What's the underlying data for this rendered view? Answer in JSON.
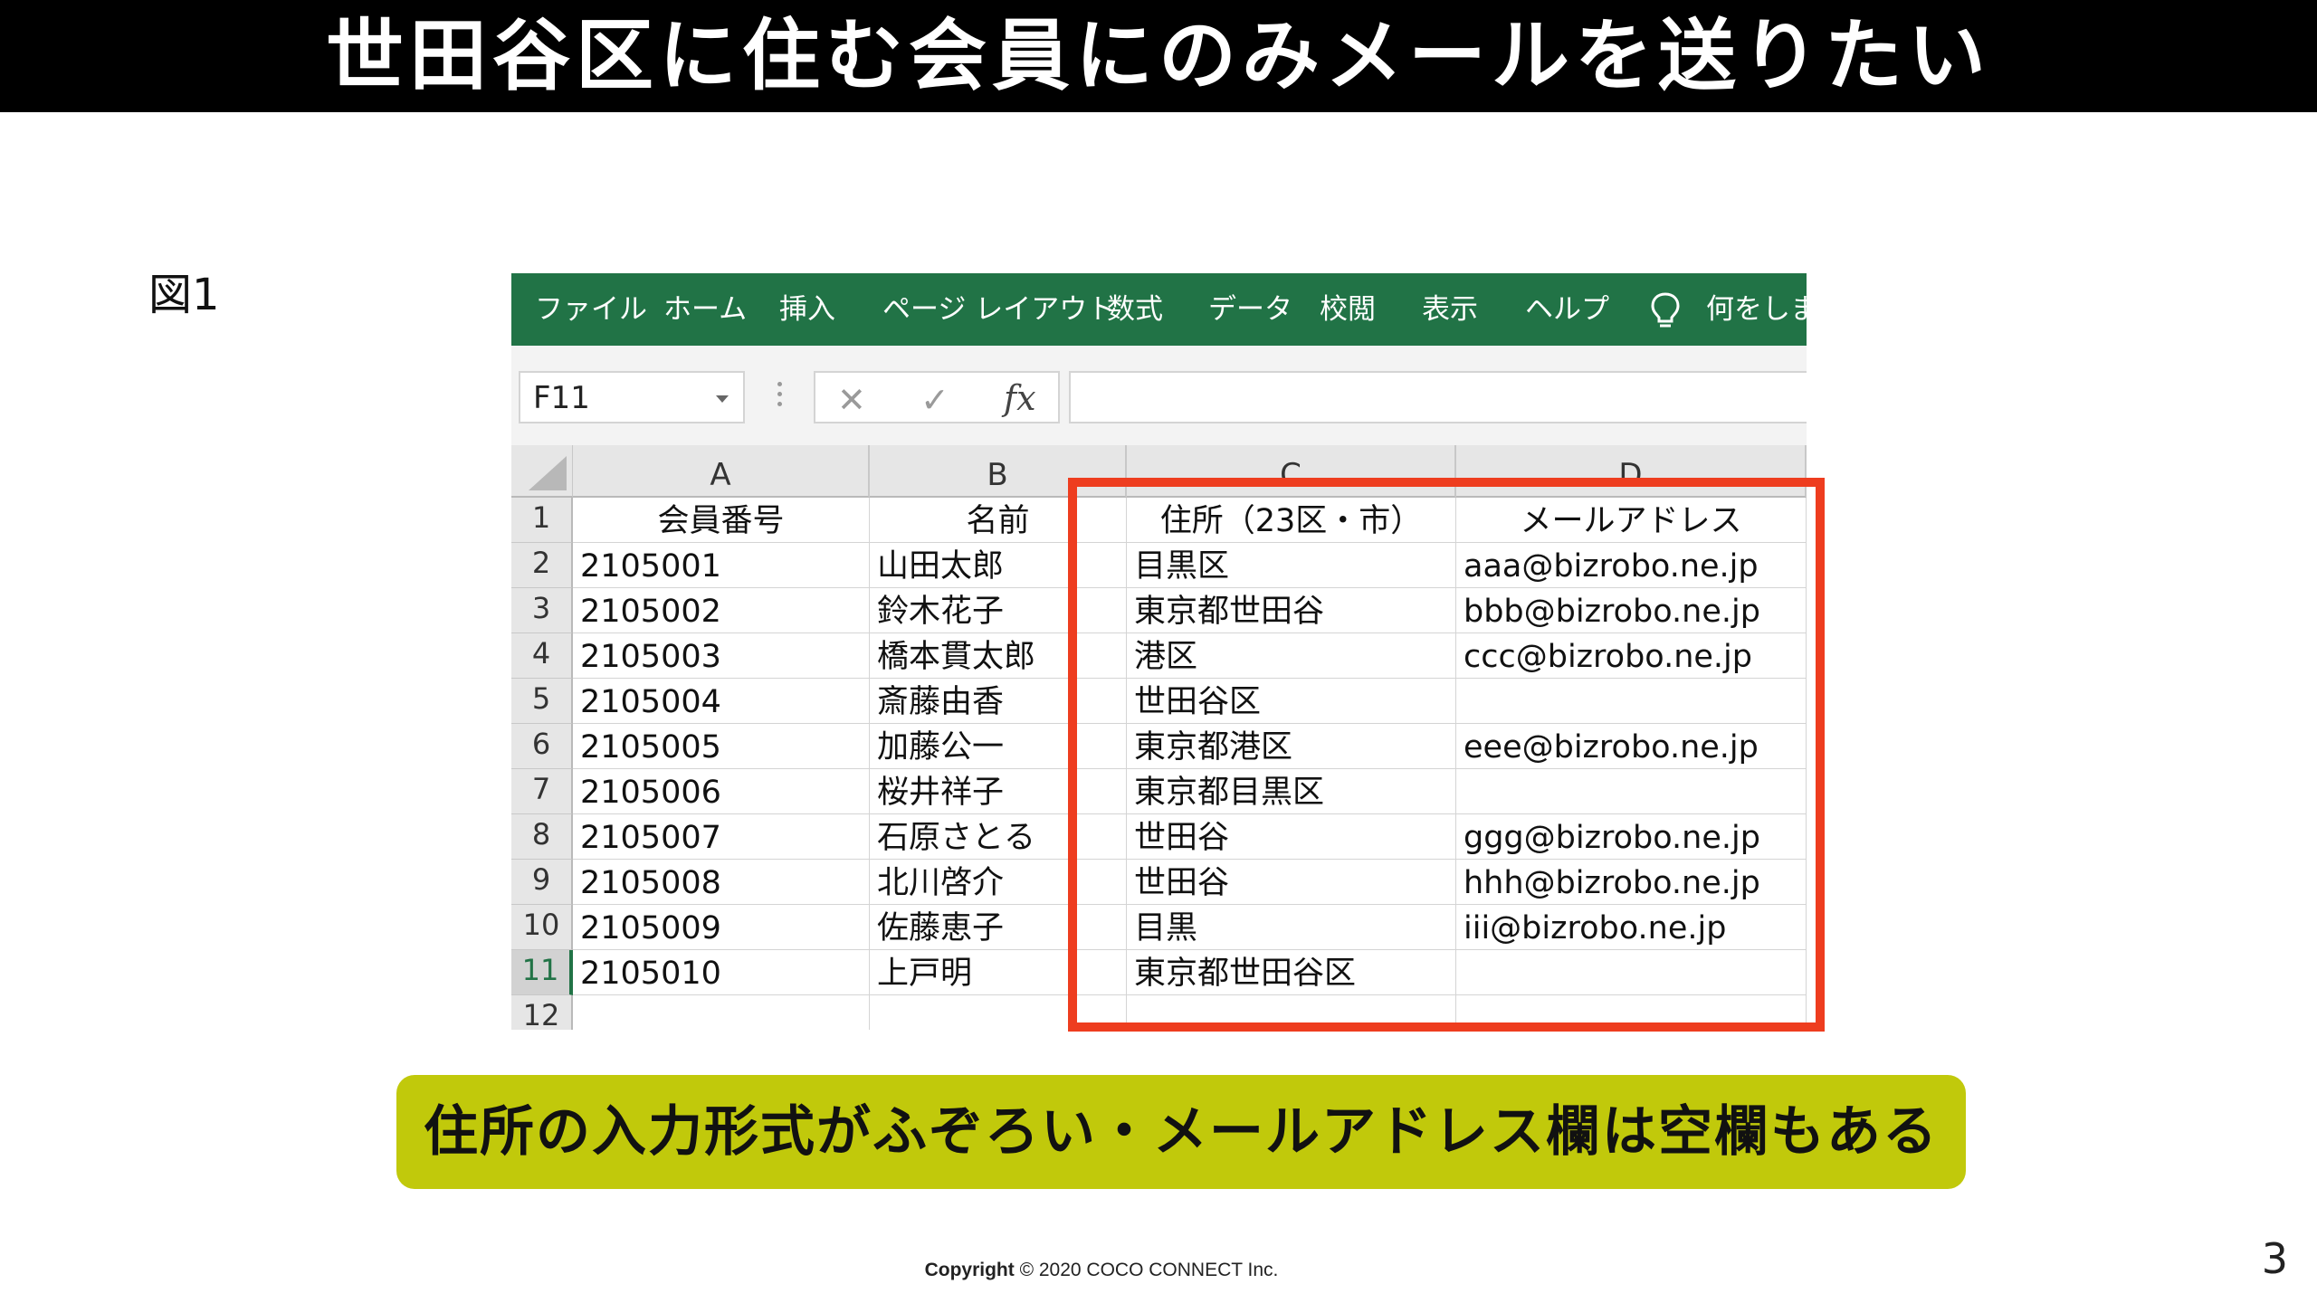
{
  "slide": {
    "title": "世田谷区に住む会員にのみメールを送りたい",
    "figure_label": "図1",
    "callout": "住所の入力形式がふぞろい・メールアドレス欄は空欄もある",
    "copyright_prefix": "Copyright",
    "copyright_rest": " © 2020 COCO CONNECT Inc.",
    "page_number": "3",
    "highlight_color": "#ee3d1f",
    "callout_color": "#c1c90b"
  },
  "excel": {
    "accent_color": "#217346",
    "ribbon_tabs": [
      "ファイル",
      "ホーム",
      "挿入",
      "ページ レイアウト",
      "数式",
      "データ",
      "校閲",
      "表示",
      "ヘルプ"
    ],
    "tell_me_icon": "lightbulb-icon",
    "tell_me_text": "何をします",
    "name_box": "F11",
    "fx_cancel_icon": "✕",
    "fx_enter_icon": "✓",
    "fx_label": "fx",
    "formula_value": "",
    "column_headers": [
      "A",
      "B",
      "C",
      "D"
    ],
    "row_numbers": [
      "1",
      "2",
      "3",
      "4",
      "5",
      "6",
      "7",
      "8",
      "9",
      "10",
      "11",
      "12"
    ],
    "active_row": "11",
    "header_row": [
      "会員番号",
      "名前",
      "住所（23区・市）",
      "メールアドレス"
    ],
    "rows": [
      [
        "2105001",
        "山田太郎",
        "目黒区",
        "aaa@bizrobo.ne.jp"
      ],
      [
        "2105002",
        "鈴木花子",
        "東京都世田谷",
        "bbb@bizrobo.ne.jp"
      ],
      [
        "2105003",
        "橋本貫太郎",
        "港区",
        "ccc@bizrobo.ne.jp"
      ],
      [
        "2105004",
        "斎藤由香",
        "世田谷区",
        ""
      ],
      [
        "2105005",
        "加藤公一",
        "東京都港区",
        "eee@bizrobo.ne.jp"
      ],
      [
        "2105006",
        "桜井祥子",
        "東京都目黒区",
        ""
      ],
      [
        "2105007",
        "石原さとる",
        "世田谷",
        "ggg@bizrobo.ne.jp"
      ],
      [
        "2105008",
        "北川啓介",
        "世田谷",
        "hhh@bizrobo.ne.jp"
      ],
      [
        "2105009",
        "佐藤恵子",
        "目黒",
        "iii@bizrobo.ne.jp"
      ],
      [
        "2105010",
        "上戸明",
        "東京都世田谷区",
        ""
      ]
    ]
  }
}
